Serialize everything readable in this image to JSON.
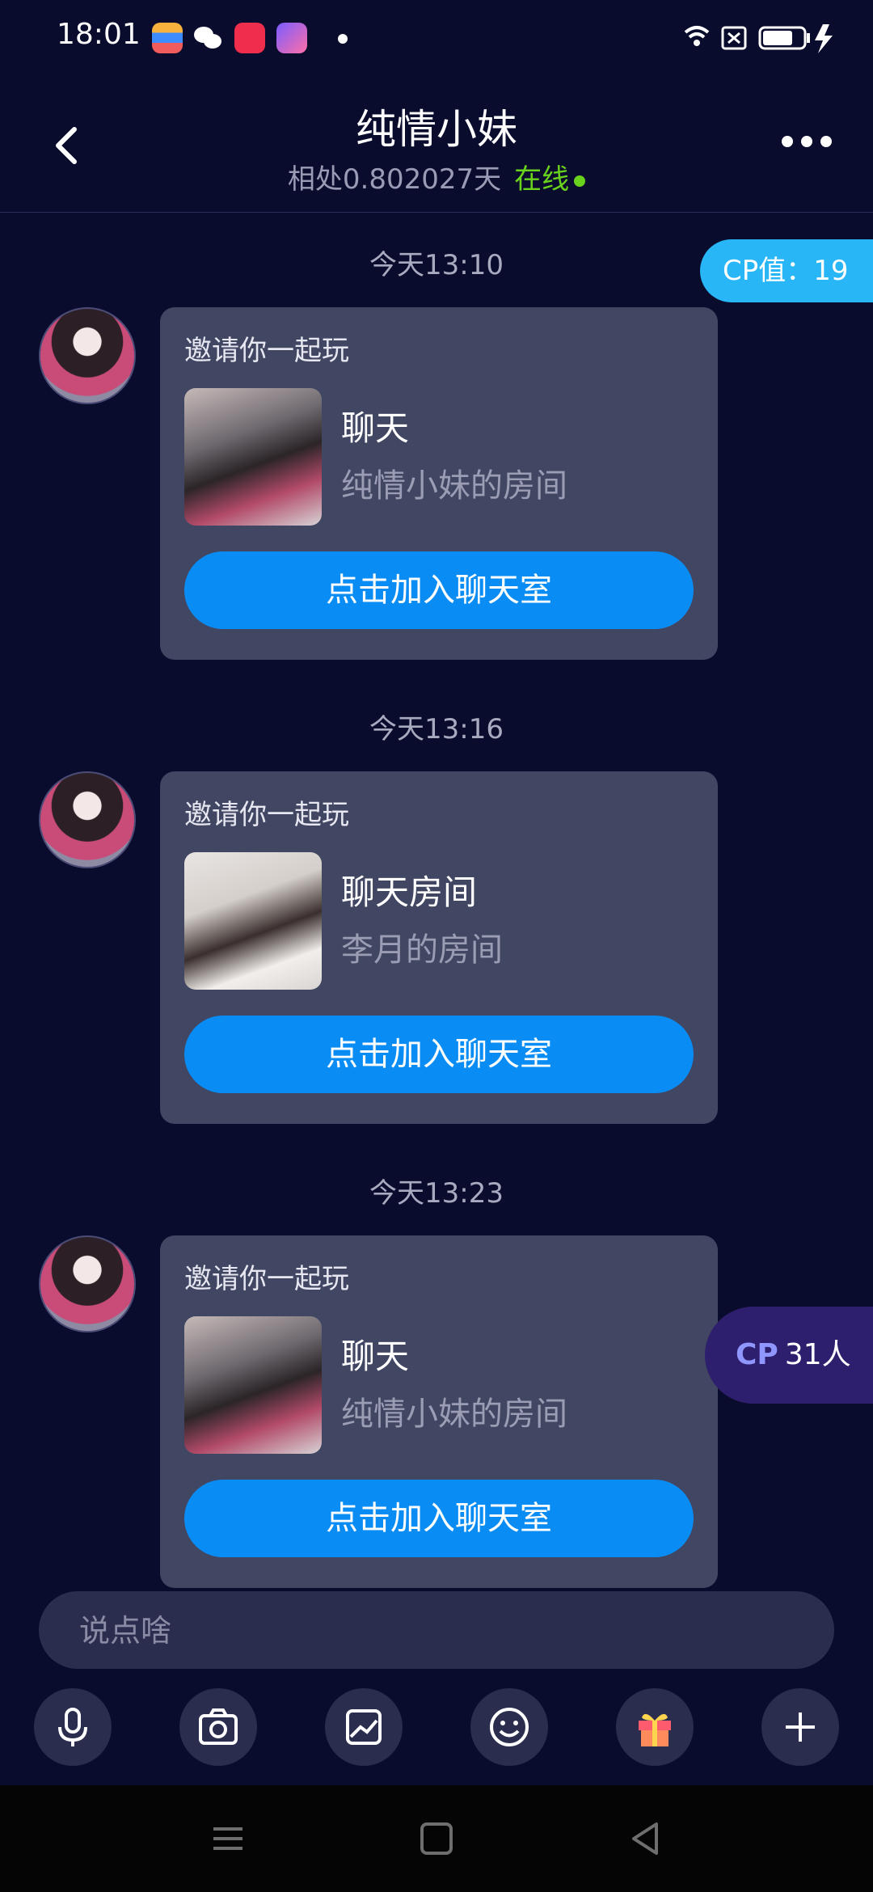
{
  "status_bar": {
    "time": "18:01"
  },
  "header": {
    "title": "纯情小妹",
    "days": "相处0.802027天",
    "online": "在线"
  },
  "cp_value": "CP值：19",
  "messages": [
    {
      "time": "今天13:10",
      "invite": "邀请你一起玩",
      "room_name": "聊天",
      "room_owner": "纯情小妹的房间",
      "button": "点击加入聊天室"
    },
    {
      "time": "今天13:16",
      "invite": "邀请你一起玩",
      "room_name": "聊天房间",
      "room_owner": "李月的房间",
      "button": "点击加入聊天室"
    },
    {
      "time": "今天13:23",
      "invite": "邀请你一起玩",
      "room_name": "聊天",
      "room_owner": "纯情小妹的房间",
      "button": "点击加入聊天室"
    }
  ],
  "cp_badge": {
    "label": "CP",
    "count": "31人"
  },
  "input": {
    "placeholder": "说点啥"
  },
  "toolbar": [
    "microphone-icon",
    "camera-icon",
    "image-icon",
    "emoji-icon",
    "gift-icon",
    "plus-icon"
  ],
  "colors": {
    "background": "#0a0c2e",
    "accent": "#0a8cf5",
    "online": "#69d21c",
    "card": "#414662"
  }
}
